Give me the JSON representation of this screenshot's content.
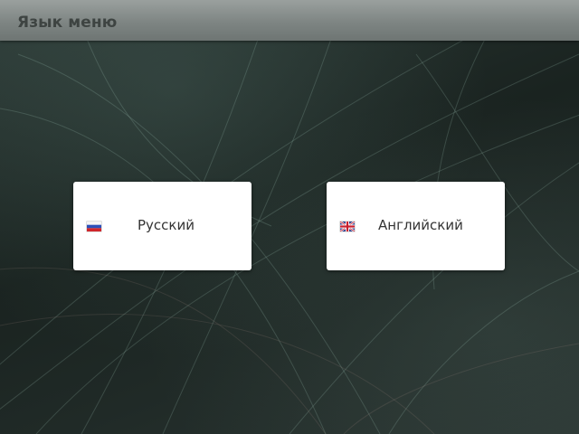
{
  "header": {
    "title": "Язык меню"
  },
  "languages": [
    {
      "label": "Русский",
      "flag_icon": "russia-flag-icon"
    },
    {
      "label": "Английский",
      "flag_icon": "uk-flag-icon"
    }
  ],
  "colors": {
    "background": "#1f2926",
    "header_bar": "#8a908e",
    "header_text": "#3e4442",
    "button_bg": "#ffffff",
    "button_text": "#333333"
  }
}
